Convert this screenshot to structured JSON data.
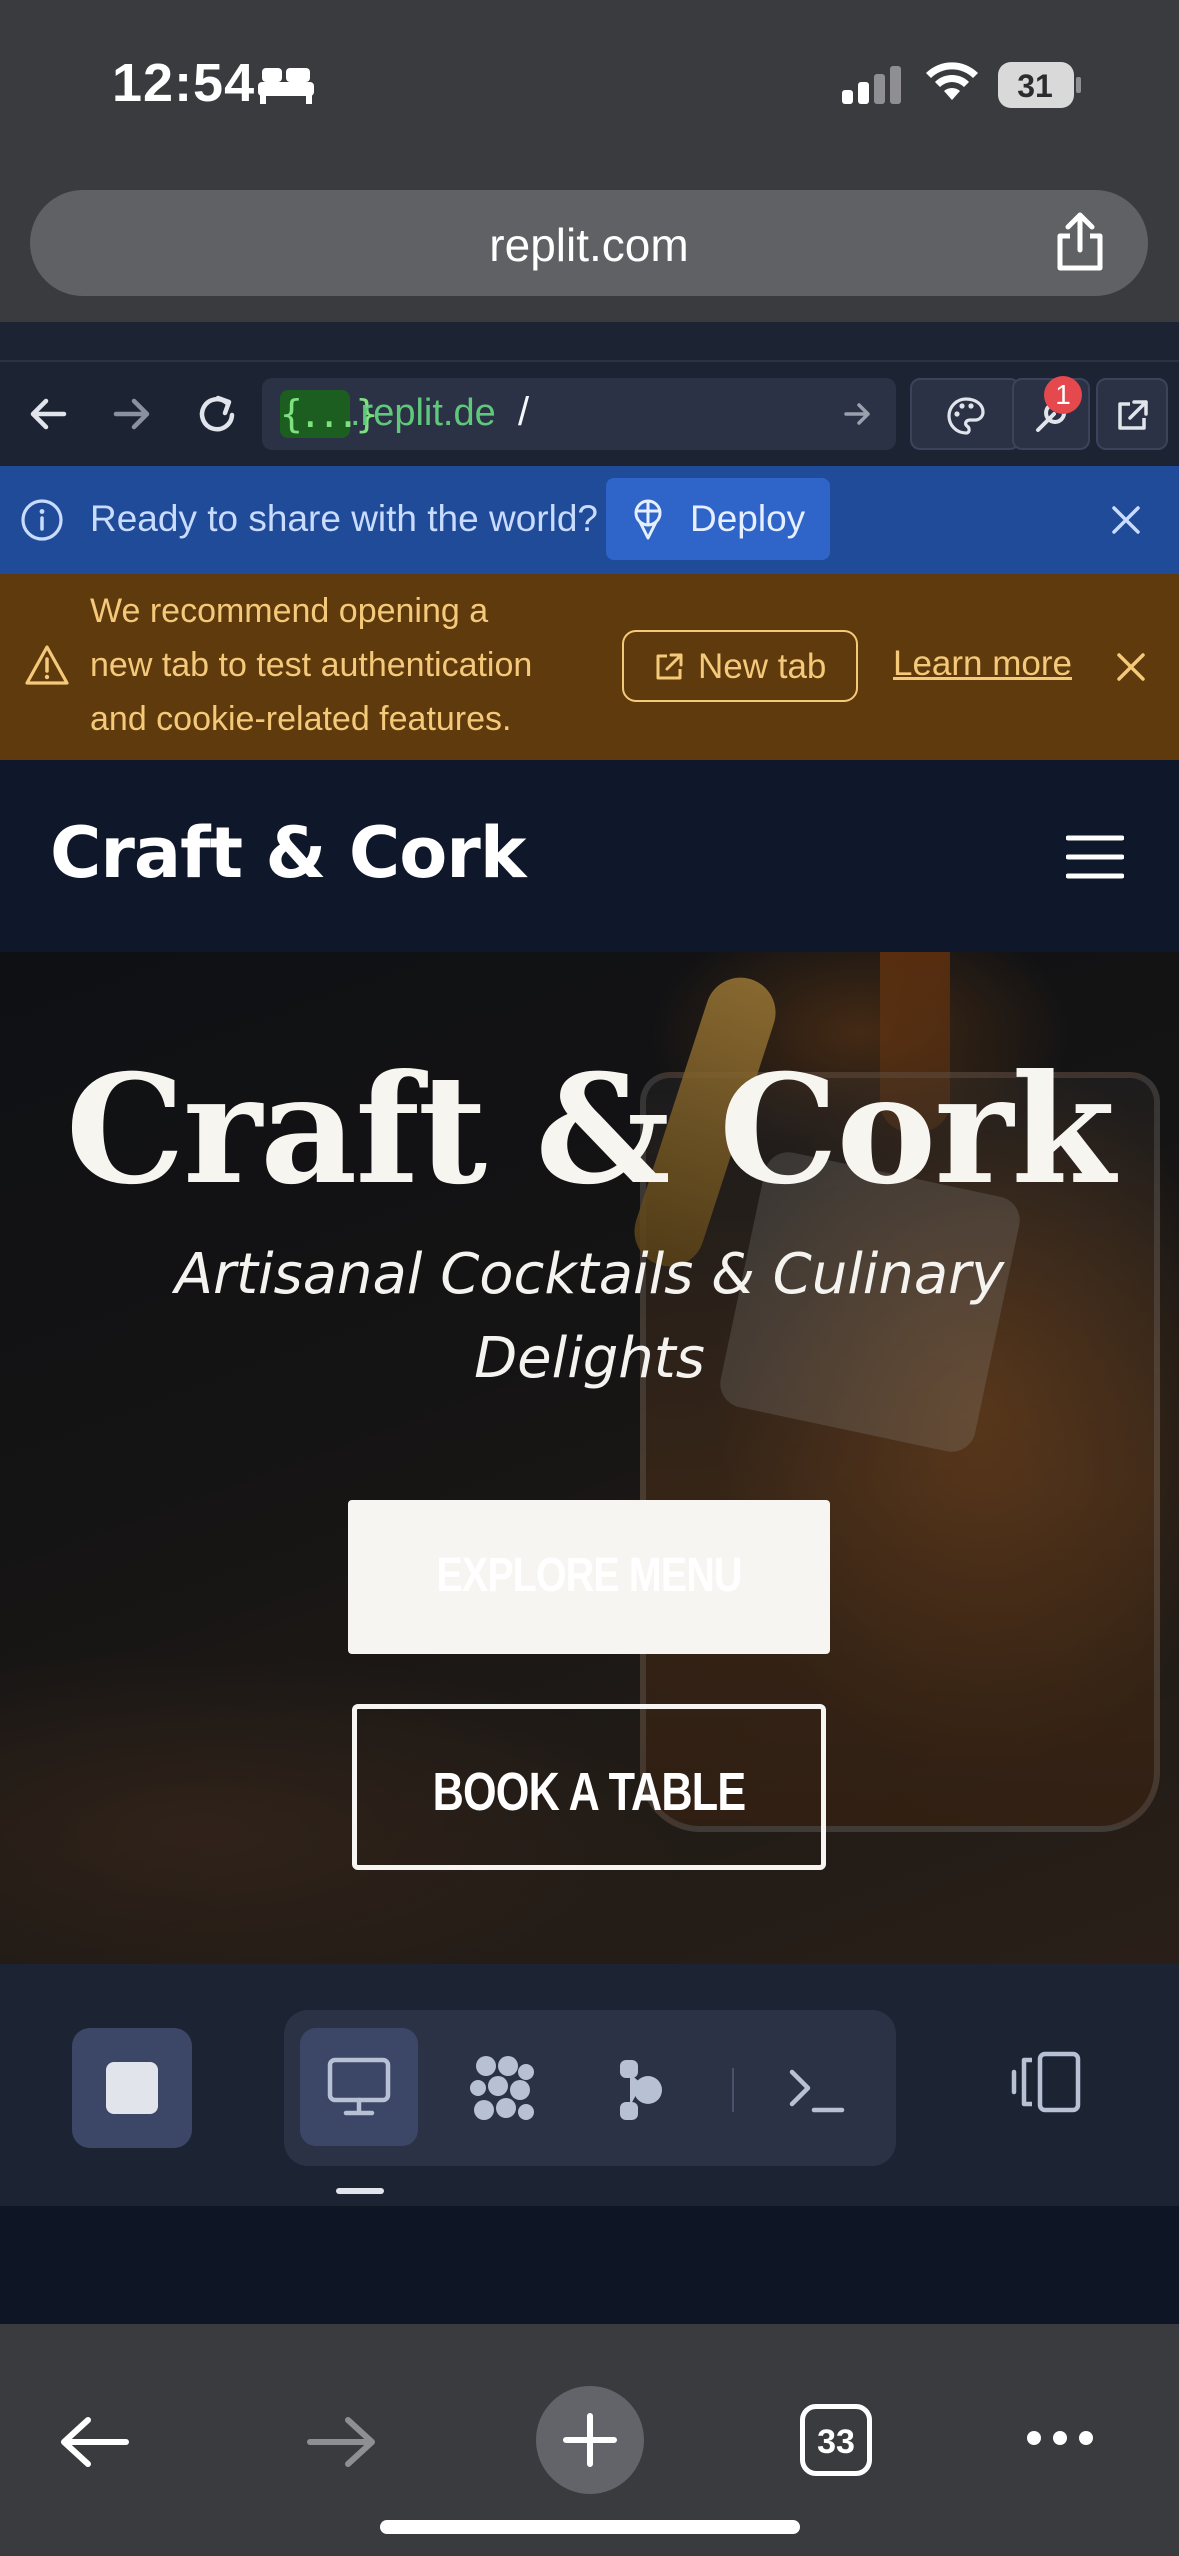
{
  "status_bar": {
    "time": "12:54",
    "battery": "31",
    "icons": [
      "bed-icon",
      "cellular-signal-icon",
      "wifi-icon",
      "battery-icon"
    ]
  },
  "safari": {
    "url": "replit.com",
    "tabs_count": "33"
  },
  "replit": {
    "url_badge": "{...}",
    "url_domain": ".replit.de",
    "url_path": "/",
    "devtools_badge": "1",
    "deploy_banner": {
      "text": "Ready to share with the world?",
      "button": "Deploy"
    },
    "warning_banner": {
      "lines": [
        "We recommend opening a",
        "new tab to test authentication",
        "and cookie-related features."
      ],
      "new_tab": "New tab",
      "learn_more": "Learn more"
    }
  },
  "site": {
    "logo": "Craft & Cork",
    "hero": {
      "title": "Craft & Cork",
      "subtitle_lines": [
        "Artisanal Cocktails & Culinary",
        "Delights"
      ],
      "explore_button": "EXPLORE MENU",
      "book_button": "BOOK A TABLE"
    }
  },
  "colors": {
    "deploy_banner_bg": "#1f4b99",
    "warning_banner_bg": "#5e3a0c",
    "warning_text": "#f5c97a",
    "site_nav_bg": "#0f172a",
    "replit_bg": "#1c2333",
    "url_green": "#5fc87a"
  }
}
